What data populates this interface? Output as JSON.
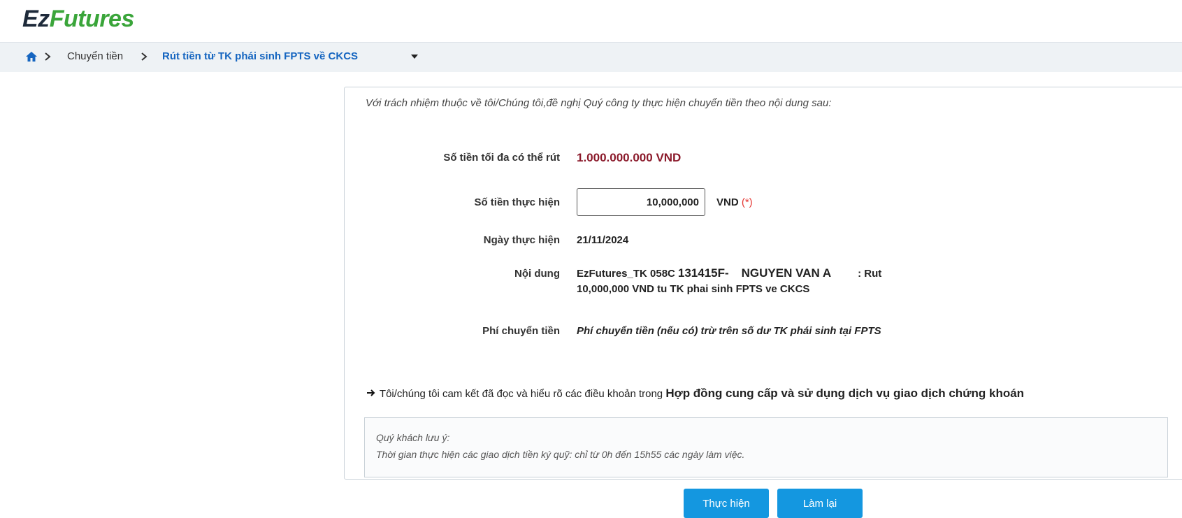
{
  "header": {
    "logo_part1": "Ez",
    "logo_part2": "Futures"
  },
  "breadcrumb": {
    "items": [
      "Chuyển tiền",
      "Rút tiền từ TK phái sinh FPTS về CKCS"
    ]
  },
  "form": {
    "intro": "Với trách nhiệm thuộc về tôi/Chúng tôi,đề nghị Quý công ty thực hiện chuyển tiền theo nội dung sau:",
    "max_label": "Số tiền tối đa có thể rút",
    "max_value": "1.000.000.000 VND",
    "amount_label": "Số tiền thực hiện",
    "amount_value": "10,000,000",
    "amount_unit": "VND",
    "required_mark": "(*)",
    "date_label": "Ngày thực hiện",
    "date_value": "21/11/2024",
    "content_label": "Nội dung",
    "content_prefix": "EzFutures_TK 058C",
    "content_account": "131415F-",
    "content_name": "NGUYEN VAN A",
    "content_suffix": ": Rut",
    "content_line2": "10,000,000 VND tu TK phai sinh FPTS ve CKCS",
    "fee_label": "Phí chuyển tiền",
    "fee_value": "Phí chuyển tiền (nếu có) trừ trên số dư TK phái sinh tại FPTS",
    "commit_text": "Tôi/chúng tôi cam kết đã đọc và hiểu rõ các điều khoản trong",
    "commit_link": "Hợp đồng cung cấp và sử dụng dịch vụ giao dịch chứng khoán"
  },
  "note": {
    "title": "Quý khách lưu ý:",
    "text": "Thời gian thực hiện các giao dịch tiền ký quỹ: chỉ từ 0h đến 15h55 các ngày làm việc."
  },
  "buttons": {
    "submit": "Thực hiện",
    "reset": "Làm lại"
  },
  "colors": {
    "logo_dark": "#1e2a3a",
    "logo_green": "#3aa53a",
    "link_blue": "#1565c0",
    "max_amount": "#8b1a2b",
    "button_blue": "#1497e0",
    "required_red": "#e53935"
  }
}
